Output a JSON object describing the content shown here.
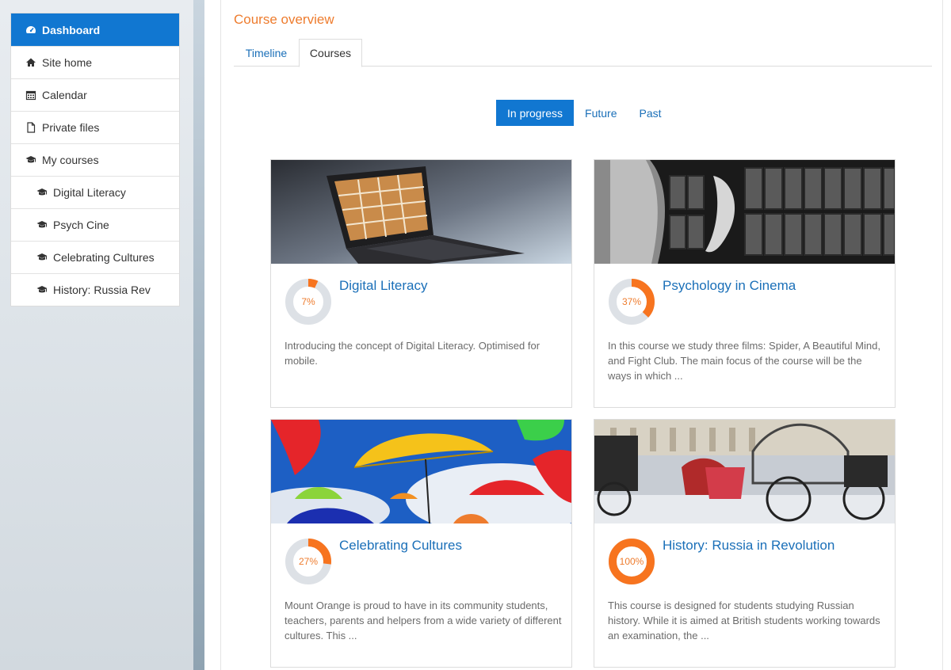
{
  "nav": {
    "items": [
      {
        "label": "Dashboard",
        "icon": "dashboard-icon"
      },
      {
        "label": "Site home",
        "icon": "home-icon"
      },
      {
        "label": "Calendar",
        "icon": "calendar-icon"
      },
      {
        "label": "Private files",
        "icon": "file-icon"
      },
      {
        "label": "My courses",
        "icon": "graduation-cap-icon"
      },
      {
        "label": "Digital Literacy",
        "icon": "graduation-cap-icon"
      },
      {
        "label": "Psych Cine",
        "icon": "graduation-cap-icon"
      },
      {
        "label": "Celebrating Cultures",
        "icon": "graduation-cap-icon"
      },
      {
        "label": "History: Russia Rev",
        "icon": "graduation-cap-icon"
      }
    ]
  },
  "overview": {
    "title": "Course overview",
    "tabs": [
      "Timeline",
      "Courses"
    ],
    "filters": [
      "In progress",
      "Future",
      "Past"
    ]
  },
  "courses": [
    {
      "title": "Digital Literacy",
      "progress": 7,
      "progress_label": "7%",
      "summary": "Introducing the concept of Digital Literacy. Optimised for mobile."
    },
    {
      "title": "Psychology in Cinema",
      "progress": 37,
      "progress_label": "37%",
      "summary": "In this course we study three films: Spider, A Beautiful Mind, and Fight Club. The main focus of the course will be the ways in which ..."
    },
    {
      "title": "Celebrating Cultures",
      "progress": 27,
      "progress_label": "27%",
      "summary": "Mount Orange is proud to have in its community students, teachers, parents and helpers from a wide variety of different cultures. This ..."
    },
    {
      "title": "History: Russia in Revolution",
      "progress": 100,
      "progress_label": "100%",
      "summary": "This course is designed for students studying Russian history. While it is aimed at British students working towards an examination, the ..."
    }
  ],
  "colors": {
    "accent": "#1177d1",
    "link": "#1a6fb8",
    "progress": "#f7741f",
    "track": "#dde1e6",
    "title": "#ee7c2e"
  }
}
